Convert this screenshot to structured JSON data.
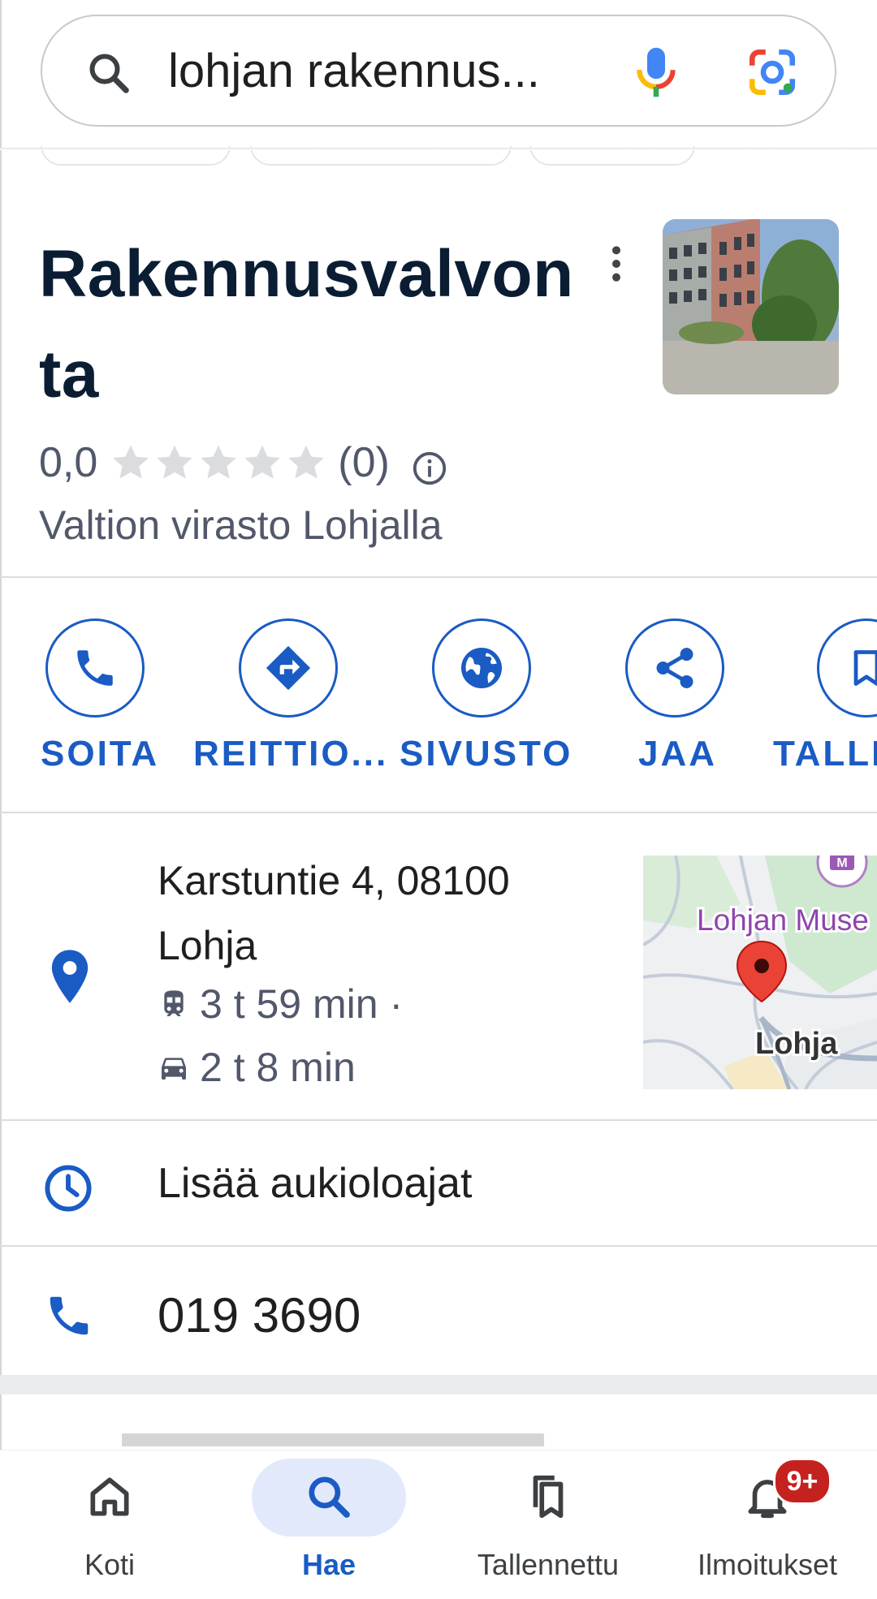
{
  "search": {
    "query": "lohjan rakennus...",
    "icon": "search-icon",
    "voice_icon": "mic-icon",
    "lens_icon": "google-lens-icon"
  },
  "place": {
    "title": "Rakennusvalvonta",
    "rating": "0,0",
    "stars_filled": 0,
    "stars_total": 5,
    "review_count": "(0)",
    "category": "Valtion virasto Lohjalla"
  },
  "actions": [
    {
      "label": "SOITA",
      "icon": "phone-icon"
    },
    {
      "label": "REITTIO...",
      "icon": "directions-icon"
    },
    {
      "label": "SIVUSTO",
      "icon": "globe-icon"
    },
    {
      "label": "JAA",
      "icon": "share-icon"
    },
    {
      "label": "TALLE",
      "icon": "bookmark-icon"
    }
  ],
  "info": {
    "address_line1": "Karstuntie 4, 08100",
    "address_line2": "Lohja",
    "transit_time": "3 t 59 min ·",
    "drive_time": "2 t 8 min",
    "hours": "Lisää aukioloajat",
    "phone": "019 3690"
  },
  "map": {
    "poi_label": "Lohjan Muse",
    "city_label": "Lohja"
  },
  "nav": {
    "items": [
      {
        "label": "Koti",
        "icon": "home-icon",
        "active": false
      },
      {
        "label": "Hae",
        "icon": "search-icon",
        "active": true
      },
      {
        "label": "Tallennettu",
        "icon": "saved-icon",
        "active": false
      },
      {
        "label": "Ilmoitukset",
        "icon": "bell-icon",
        "active": false
      }
    ],
    "badge": "9+"
  },
  "colors": {
    "accent": "#1a5bc4",
    "title": "#0b1d33",
    "secondary_text": "#51586a",
    "active_pill": "#e2e9fb",
    "badge": "#c5221f"
  }
}
